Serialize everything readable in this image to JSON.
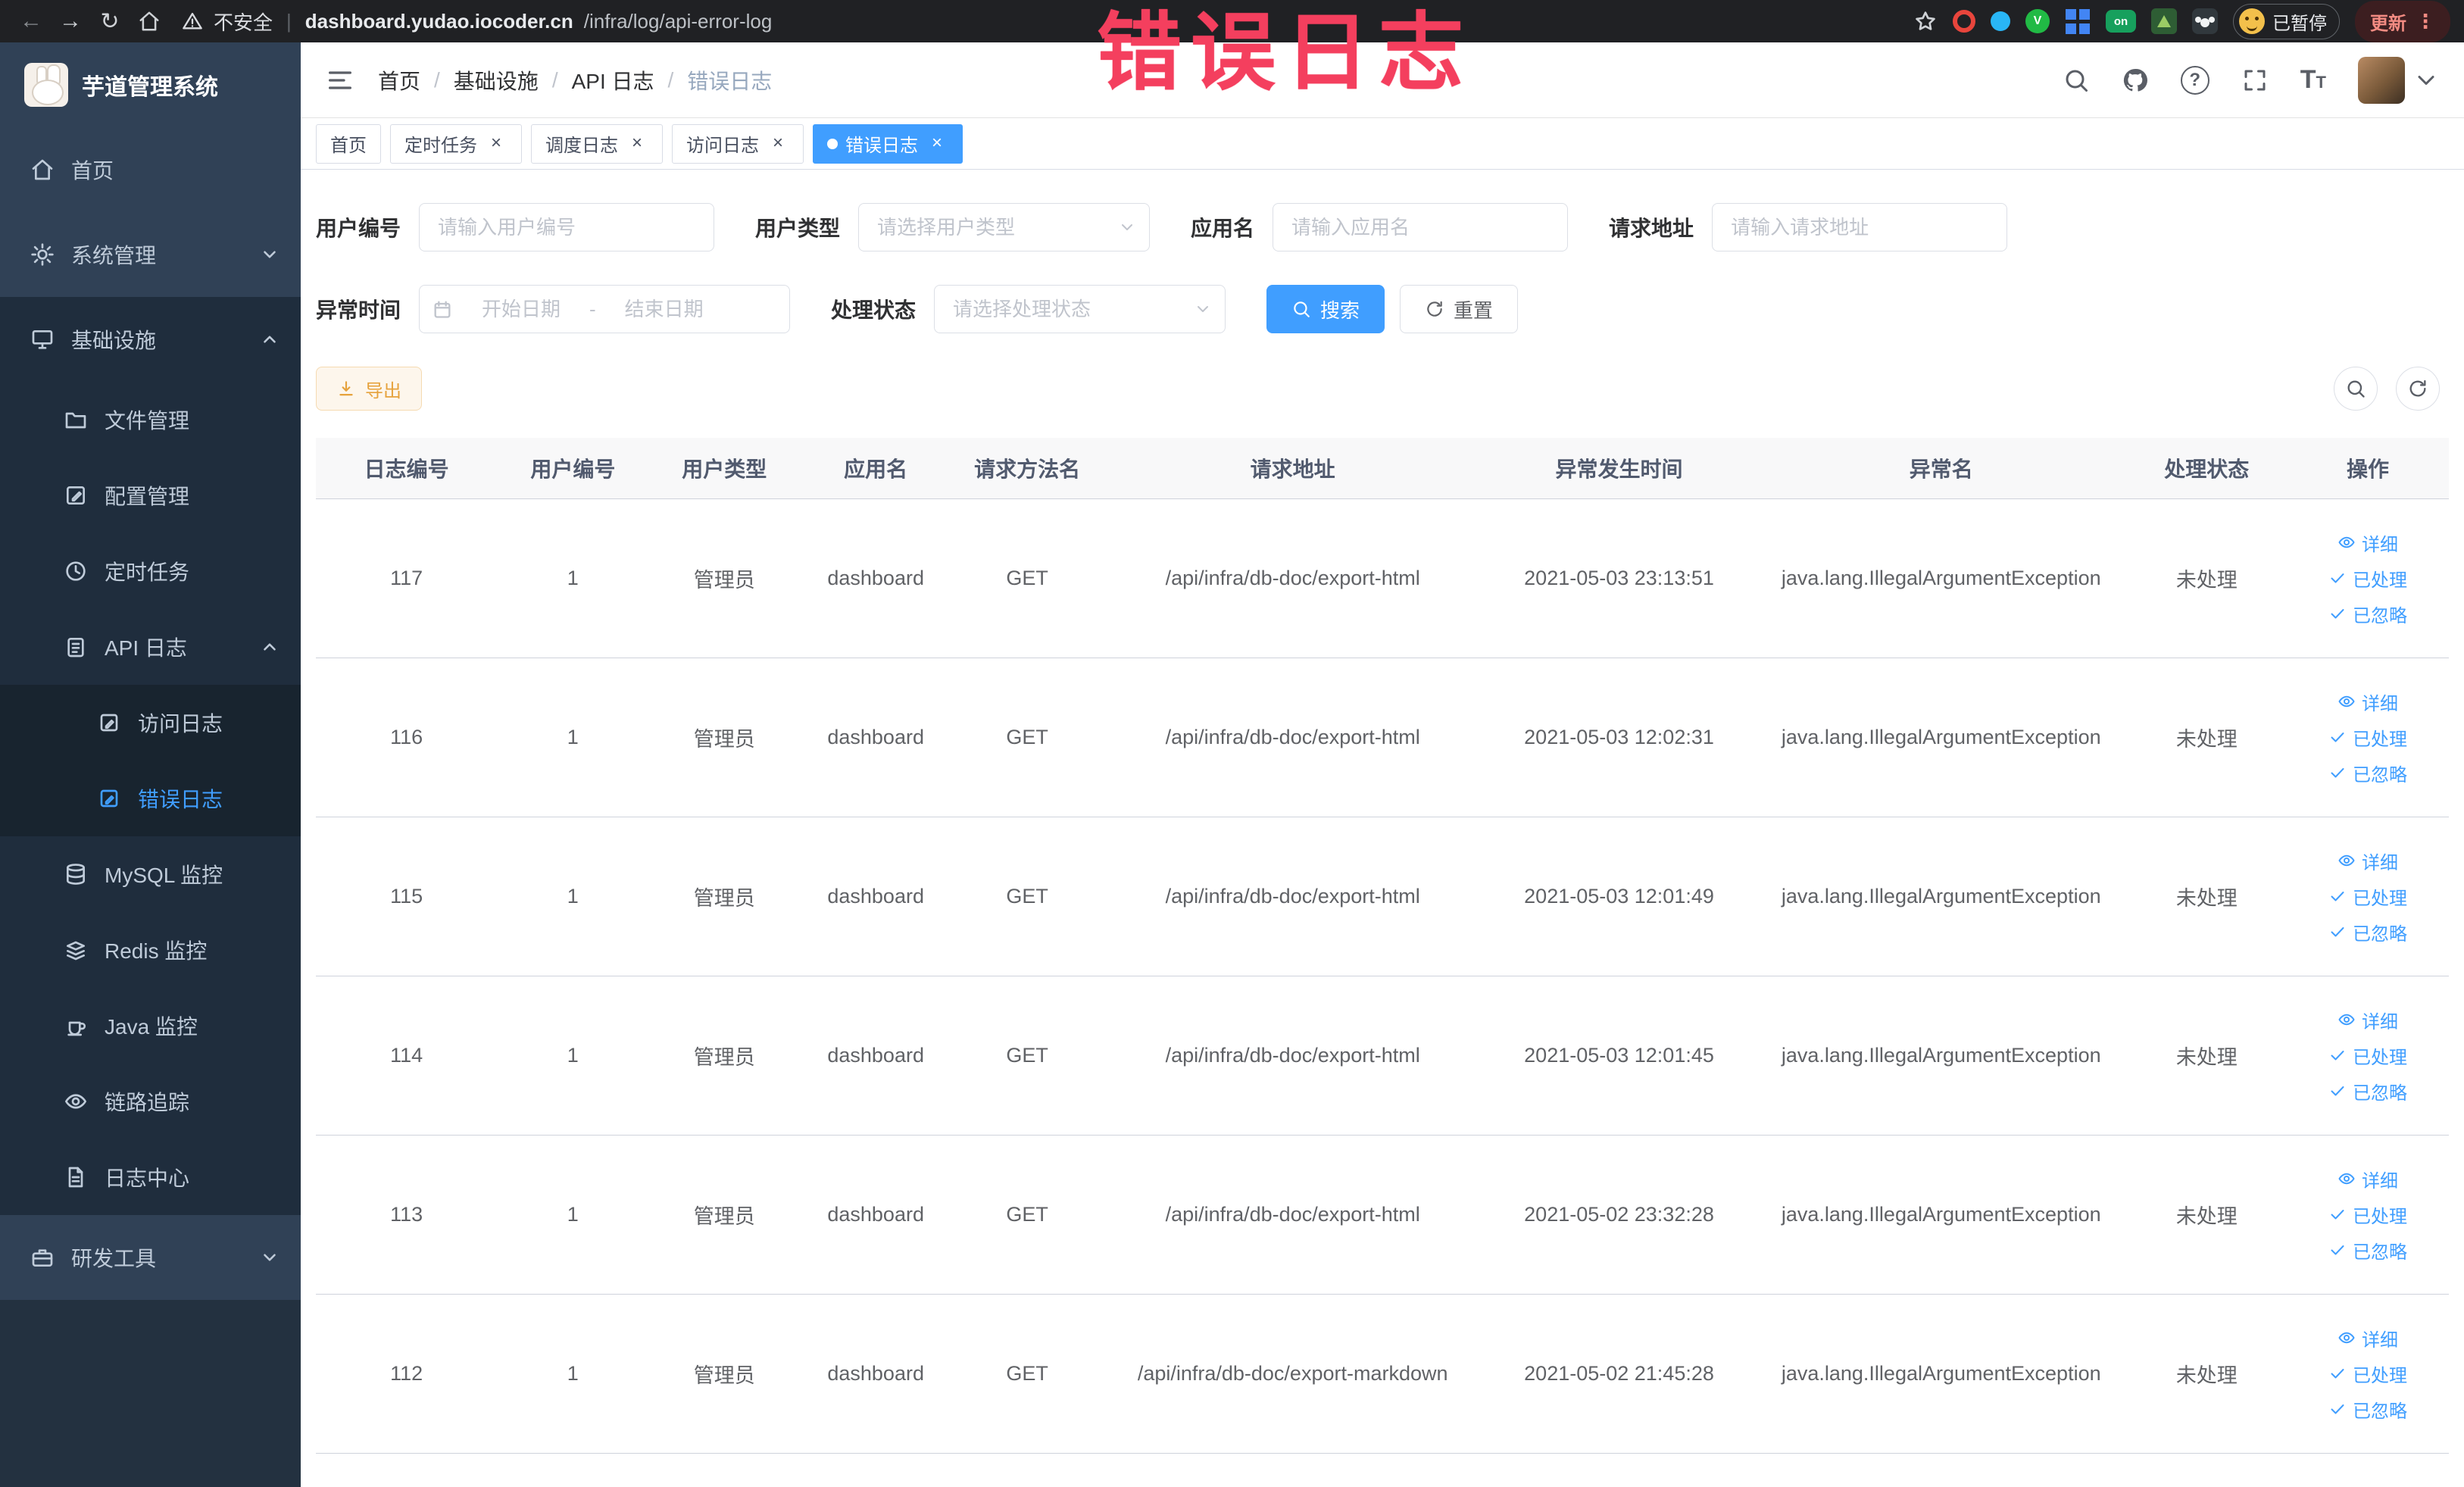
{
  "glyphs": {
    "back": "←",
    "forward": "→",
    "reload": "↻",
    "pipe": "|",
    "kebab": "⋮",
    "close": "×",
    "slash": "/",
    "question": "?",
    "font_big": "T",
    "font_small": "T",
    "on_badge": "on"
  },
  "browser": {
    "security": "不安全",
    "url_domain": "dashboard.yudao.iocoder.cn",
    "url_path": "/infra/log/api-error-log",
    "paused": "已暂停",
    "update": "更新"
  },
  "watermark": "错误日志",
  "sidebar": {
    "title": "芋道管理系统",
    "items": [
      {
        "label": "首页"
      },
      {
        "label": "系统管理"
      },
      {
        "label": "基础设施"
      },
      {
        "label": "文件管理"
      },
      {
        "label": "配置管理"
      },
      {
        "label": "定时任务"
      },
      {
        "label": "API 日志"
      },
      {
        "label": "访问日志"
      },
      {
        "label": "错误日志"
      },
      {
        "label": "MySQL 监控"
      },
      {
        "label": "Redis 监控"
      },
      {
        "label": "Java 监控"
      },
      {
        "label": "链路追踪"
      },
      {
        "label": "日志中心"
      },
      {
        "label": "研发工具"
      }
    ]
  },
  "breadcrumb": [
    "首页",
    "基础设施",
    "API 日志",
    "错误日志"
  ],
  "tabs": [
    {
      "label": "首页"
    },
    {
      "label": "定时任务"
    },
    {
      "label": "调度日志"
    },
    {
      "label": "访问日志"
    },
    {
      "label": "错误日志"
    }
  ],
  "filters": {
    "user_id": {
      "label": "用户编号",
      "placeholder": "请输入用户编号"
    },
    "user_type": {
      "label": "用户类型",
      "placeholder": "请选择用户类型"
    },
    "app_name": {
      "label": "应用名",
      "placeholder": "请输入应用名"
    },
    "request_url": {
      "label": "请求地址",
      "placeholder": "请输入请求地址"
    },
    "exception_time": {
      "label": "异常时间",
      "start": "开始日期",
      "separator": "-",
      "end": "结束日期"
    },
    "status": {
      "label": "处理状态",
      "placeholder": "请选择处理状态"
    },
    "search": "搜索",
    "reset": "重置"
  },
  "toolbar": {
    "export": "导出"
  },
  "table": {
    "columns": [
      "日志编号",
      "用户编号",
      "用户类型",
      "应用名",
      "请求方法名",
      "请求地址",
      "异常发生时间",
      "异常名",
      "处理状态",
      "操作"
    ],
    "actions": {
      "detail": "详细",
      "processed": "已处理",
      "ignored": "已忽略"
    },
    "rows": [
      {
        "id": "117",
        "user_id": "1",
        "user_type": "管理员",
        "app": "dashboard",
        "method": "GET",
        "url": "/api/infra/db-doc/export-html",
        "time": "2021-05-03 23:13:51",
        "exception": "java.lang.IllegalArgumentException",
        "status": "未处理"
      },
      {
        "id": "116",
        "user_id": "1",
        "user_type": "管理员",
        "app": "dashboard",
        "method": "GET",
        "url": "/api/infra/db-doc/export-html",
        "time": "2021-05-03 12:02:31",
        "exception": "java.lang.IllegalArgumentException",
        "status": "未处理"
      },
      {
        "id": "115",
        "user_id": "1",
        "user_type": "管理员",
        "app": "dashboard",
        "method": "GET",
        "url": "/api/infra/db-doc/export-html",
        "time": "2021-05-03 12:01:49",
        "exception": "java.lang.IllegalArgumentException",
        "status": "未处理"
      },
      {
        "id": "114",
        "user_id": "1",
        "user_type": "管理员",
        "app": "dashboard",
        "method": "GET",
        "url": "/api/infra/db-doc/export-html",
        "time": "2021-05-03 12:01:45",
        "exception": "java.lang.IllegalArgumentException",
        "status": "未处理"
      },
      {
        "id": "113",
        "user_id": "1",
        "user_type": "管理员",
        "app": "dashboard",
        "method": "GET",
        "url": "/api/infra/db-doc/export-html",
        "time": "2021-05-02 23:32:28",
        "exception": "java.lang.IllegalArgumentException",
        "status": "未处理"
      },
      {
        "id": "112",
        "user_id": "1",
        "user_type": "管理员",
        "app": "dashboard",
        "method": "GET",
        "url": "/api/infra/db-doc/export-markdown",
        "time": "2021-05-02 21:45:28",
        "exception": "java.lang.IllegalArgumentException",
        "status": "未处理"
      }
    ]
  }
}
